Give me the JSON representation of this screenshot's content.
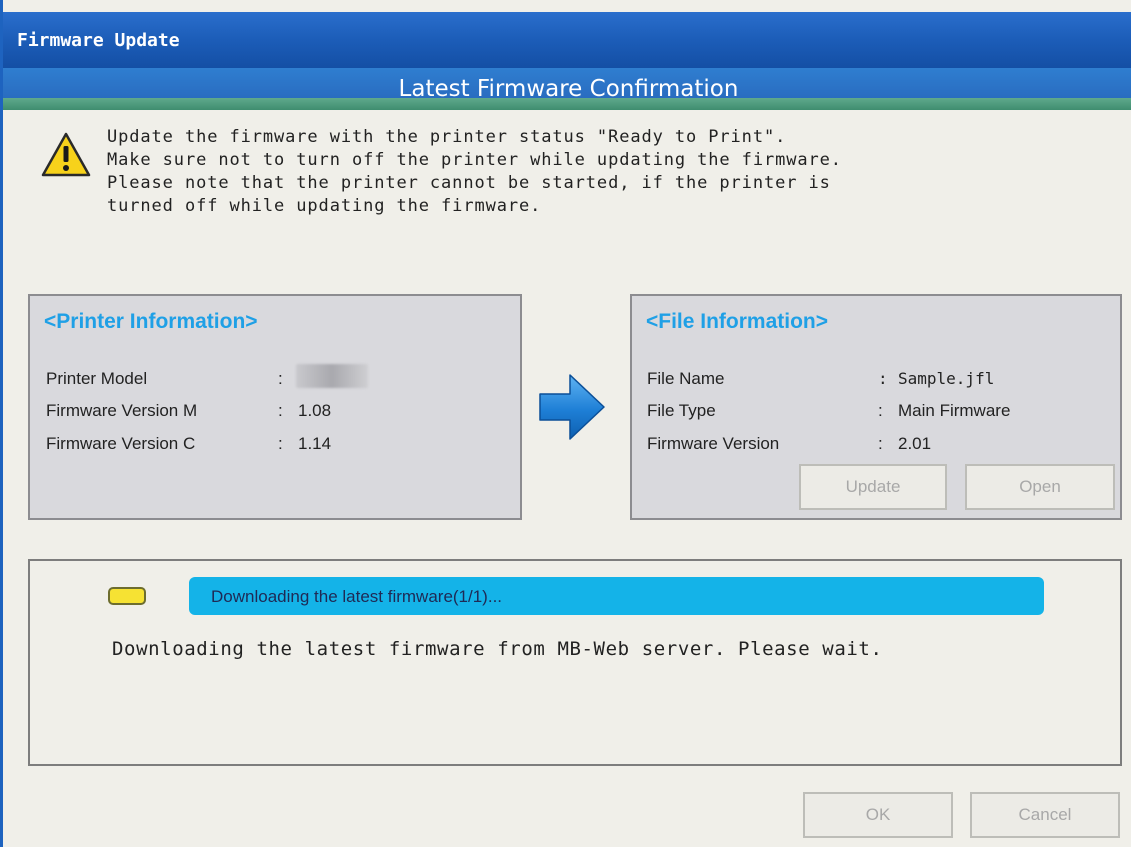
{
  "window": {
    "title": "Firmware Update"
  },
  "header": {
    "subtitle": "Latest Firmware Confirmation"
  },
  "warning": {
    "icon": "warning-triangle-icon",
    "text": "Update the firmware with the printer status \"Ready to Print\".\nMake sure not to turn off the printer while updating the firmware.\nPlease note that the printer cannot be started, if the printer is\nturned off while updating the firmware."
  },
  "printer_info": {
    "heading": "<Printer Information>",
    "rows": [
      {
        "label": "Printer Model",
        "sep": ":",
        "value": ""
      },
      {
        "label": "Firmware Version M",
        "sep": ":",
        "value": "1.08"
      },
      {
        "label": "Firmware Version C",
        "sep": ":",
        "value": "1.14"
      }
    ]
  },
  "file_info": {
    "heading": "<File Information>",
    "rows": [
      {
        "label": "File Name",
        "sep": ":",
        "value": "Sample.jfl"
      },
      {
        "label": "File Type",
        "sep": ":",
        "value": "Main Firmware"
      },
      {
        "label": "Firmware Version",
        "sep": ":",
        "value": "2.01"
      }
    ],
    "update_label": "Update",
    "open_label": "Open"
  },
  "status": {
    "progress_text": "Downloading the latest firmware(1/1)...",
    "message": "Downloading the latest firmware from MB-Web server. Please wait.",
    "indicator_color": "#f6e233",
    "progress_color": "#14b3e8"
  },
  "footer": {
    "ok_label": "OK",
    "cancel_label": "Cancel"
  }
}
